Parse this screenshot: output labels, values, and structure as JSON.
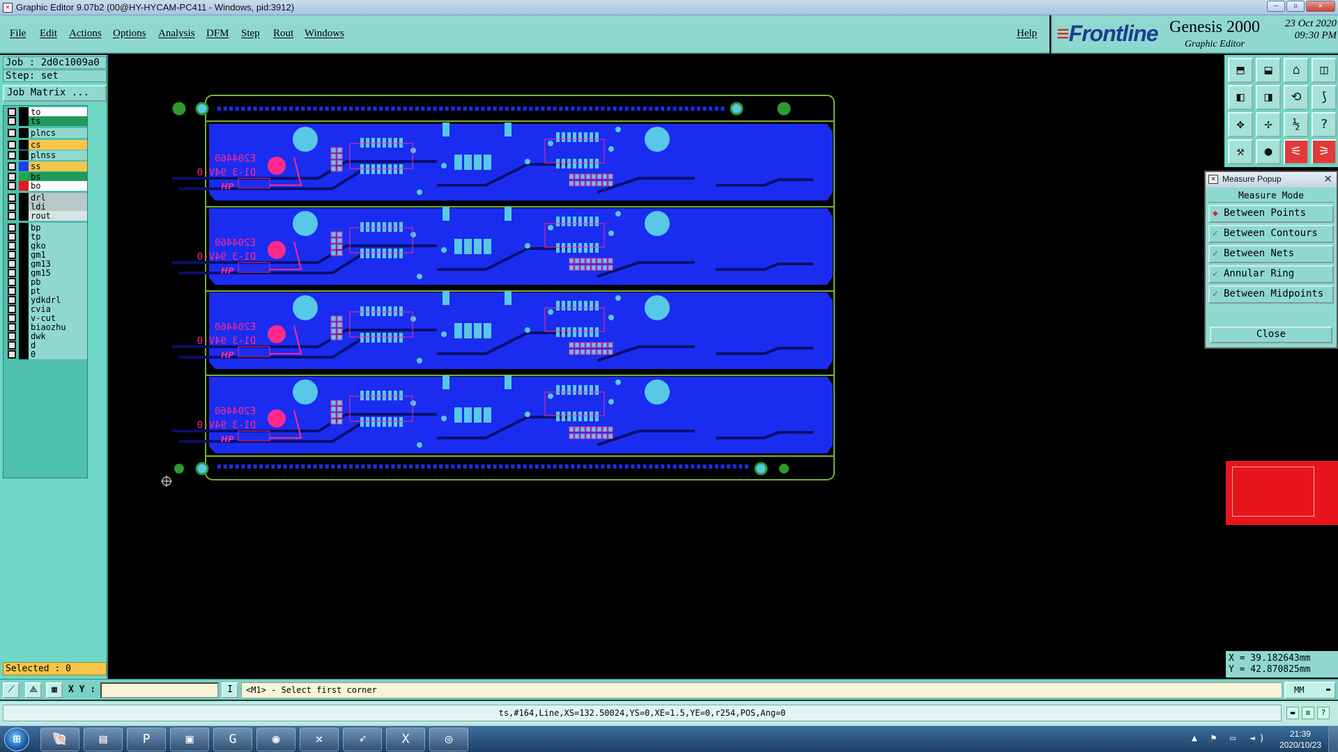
{
  "window": {
    "title": "Graphic Editor 9.07b2 (00@HY-HYCAM-PC411 - Windows, pid:3912)"
  },
  "menubar": {
    "items": [
      "File",
      "Edit",
      "Actions",
      "Options",
      "Analysis",
      "DFM",
      "Step",
      "Rout",
      "Windows"
    ],
    "help": "Help"
  },
  "brand": {
    "logo": "Frontline",
    "product": "Genesis 2000",
    "subtitle": "Graphic Editor",
    "date": "23 Oct 2020",
    "time": "09:30 PM"
  },
  "job": {
    "job_label": "Job : 2d0c1009a0",
    "step_label": "Step: set",
    "matrix_button": "Job Matrix ..."
  },
  "layers": [
    {
      "name": "to",
      "color": "#ffffff",
      "swatch": "#000000"
    },
    {
      "name": "ts",
      "color": "#1f9a5a",
      "swatch": "#000000"
    },
    {
      "name": "plncs",
      "color": "#8fd8d0",
      "swatch": "#000000"
    },
    {
      "name": "cs",
      "color": "#f6c64a",
      "swatch": "#000000"
    },
    {
      "name": "plnss",
      "color": "#8fd8d0",
      "swatch": "#000000"
    },
    {
      "name": "ss",
      "color": "#f6c64a",
      "swatch": "#1a3cff"
    },
    {
      "name": "bs",
      "color": "#1f9a5a",
      "swatch": "#1fa84a"
    },
    {
      "name": "bo",
      "color": "#ffffff",
      "swatch": "#e21a1a"
    },
    {
      "name": "drl",
      "color": "#b9c9c9",
      "swatch": "#000000"
    },
    {
      "name": "ldi",
      "color": "#b9c9c9",
      "swatch": "#000000"
    },
    {
      "name": "rout",
      "color": "#d8e4e4",
      "swatch": "#000000"
    },
    {
      "name": "bp",
      "color": "#8fd8d0",
      "swatch": "#000000"
    },
    {
      "name": "tp",
      "color": "#8fd8d0",
      "swatch": "#000000"
    },
    {
      "name": "gko",
      "color": "#8fd8d0",
      "swatch": "#000000"
    },
    {
      "name": "gm1",
      "color": "#8fd8d0",
      "swatch": "#000000"
    },
    {
      "name": "gm13",
      "color": "#8fd8d0",
      "swatch": "#000000"
    },
    {
      "name": "gm15",
      "color": "#8fd8d0",
      "swatch": "#000000"
    },
    {
      "name": "pb",
      "color": "#8fd8d0",
      "swatch": "#000000"
    },
    {
      "name": "pt",
      "color": "#8fd8d0",
      "swatch": "#000000"
    },
    {
      "name": "ydkdrl",
      "color": "#8fd8d0",
      "swatch": "#000000"
    },
    {
      "name": "cvia",
      "color": "#8fd8d0",
      "swatch": "#000000"
    },
    {
      "name": "v-cut",
      "color": "#8fd8d0",
      "swatch": "#000000"
    },
    {
      "name": "biaozhu",
      "color": "#8fd8d0",
      "swatch": "#000000"
    },
    {
      "name": "dwk",
      "color": "#8fd8d0",
      "swatch": "#000000"
    },
    {
      "name": "d",
      "color": "#8fd8d0",
      "swatch": "#000000"
    },
    {
      "name": "0",
      "color": "#8fd8d0",
      "swatch": "#000000"
    }
  ],
  "selected": "Selected : 0",
  "board": {
    "panel_text_1": "E204460",
    "panel_text_2": "D1-3 94V-0",
    "panel_text_3": "HP",
    "colors": {
      "copper": "#1a2cf0",
      "pad": "#58c8e8",
      "silk": "#ff2a8a",
      "outline": "#7ab03a"
    }
  },
  "measure": {
    "title": "Measure Popup",
    "header": "Measure Mode",
    "options": [
      "Between Points",
      "Between Contours",
      "Between Nets",
      "Annular Ring",
      "Between Midpoints"
    ],
    "selected_option": "Between Points",
    "close": "Close"
  },
  "coords": {
    "x": "X = 39.182643mm",
    "y": "Y = 42.870825mm"
  },
  "command": {
    "xy_label": "X Y :",
    "xy_value": "",
    "prompt": "<M1> - Select first corner",
    "units": "MM"
  },
  "status": "ts,#164,Line,XS=132.50024,YS=0,XE=1.5,YE=0,r254,POS,Ang=0",
  "taskbar": {
    "time": "21:39",
    "date": "2020/10/23"
  }
}
